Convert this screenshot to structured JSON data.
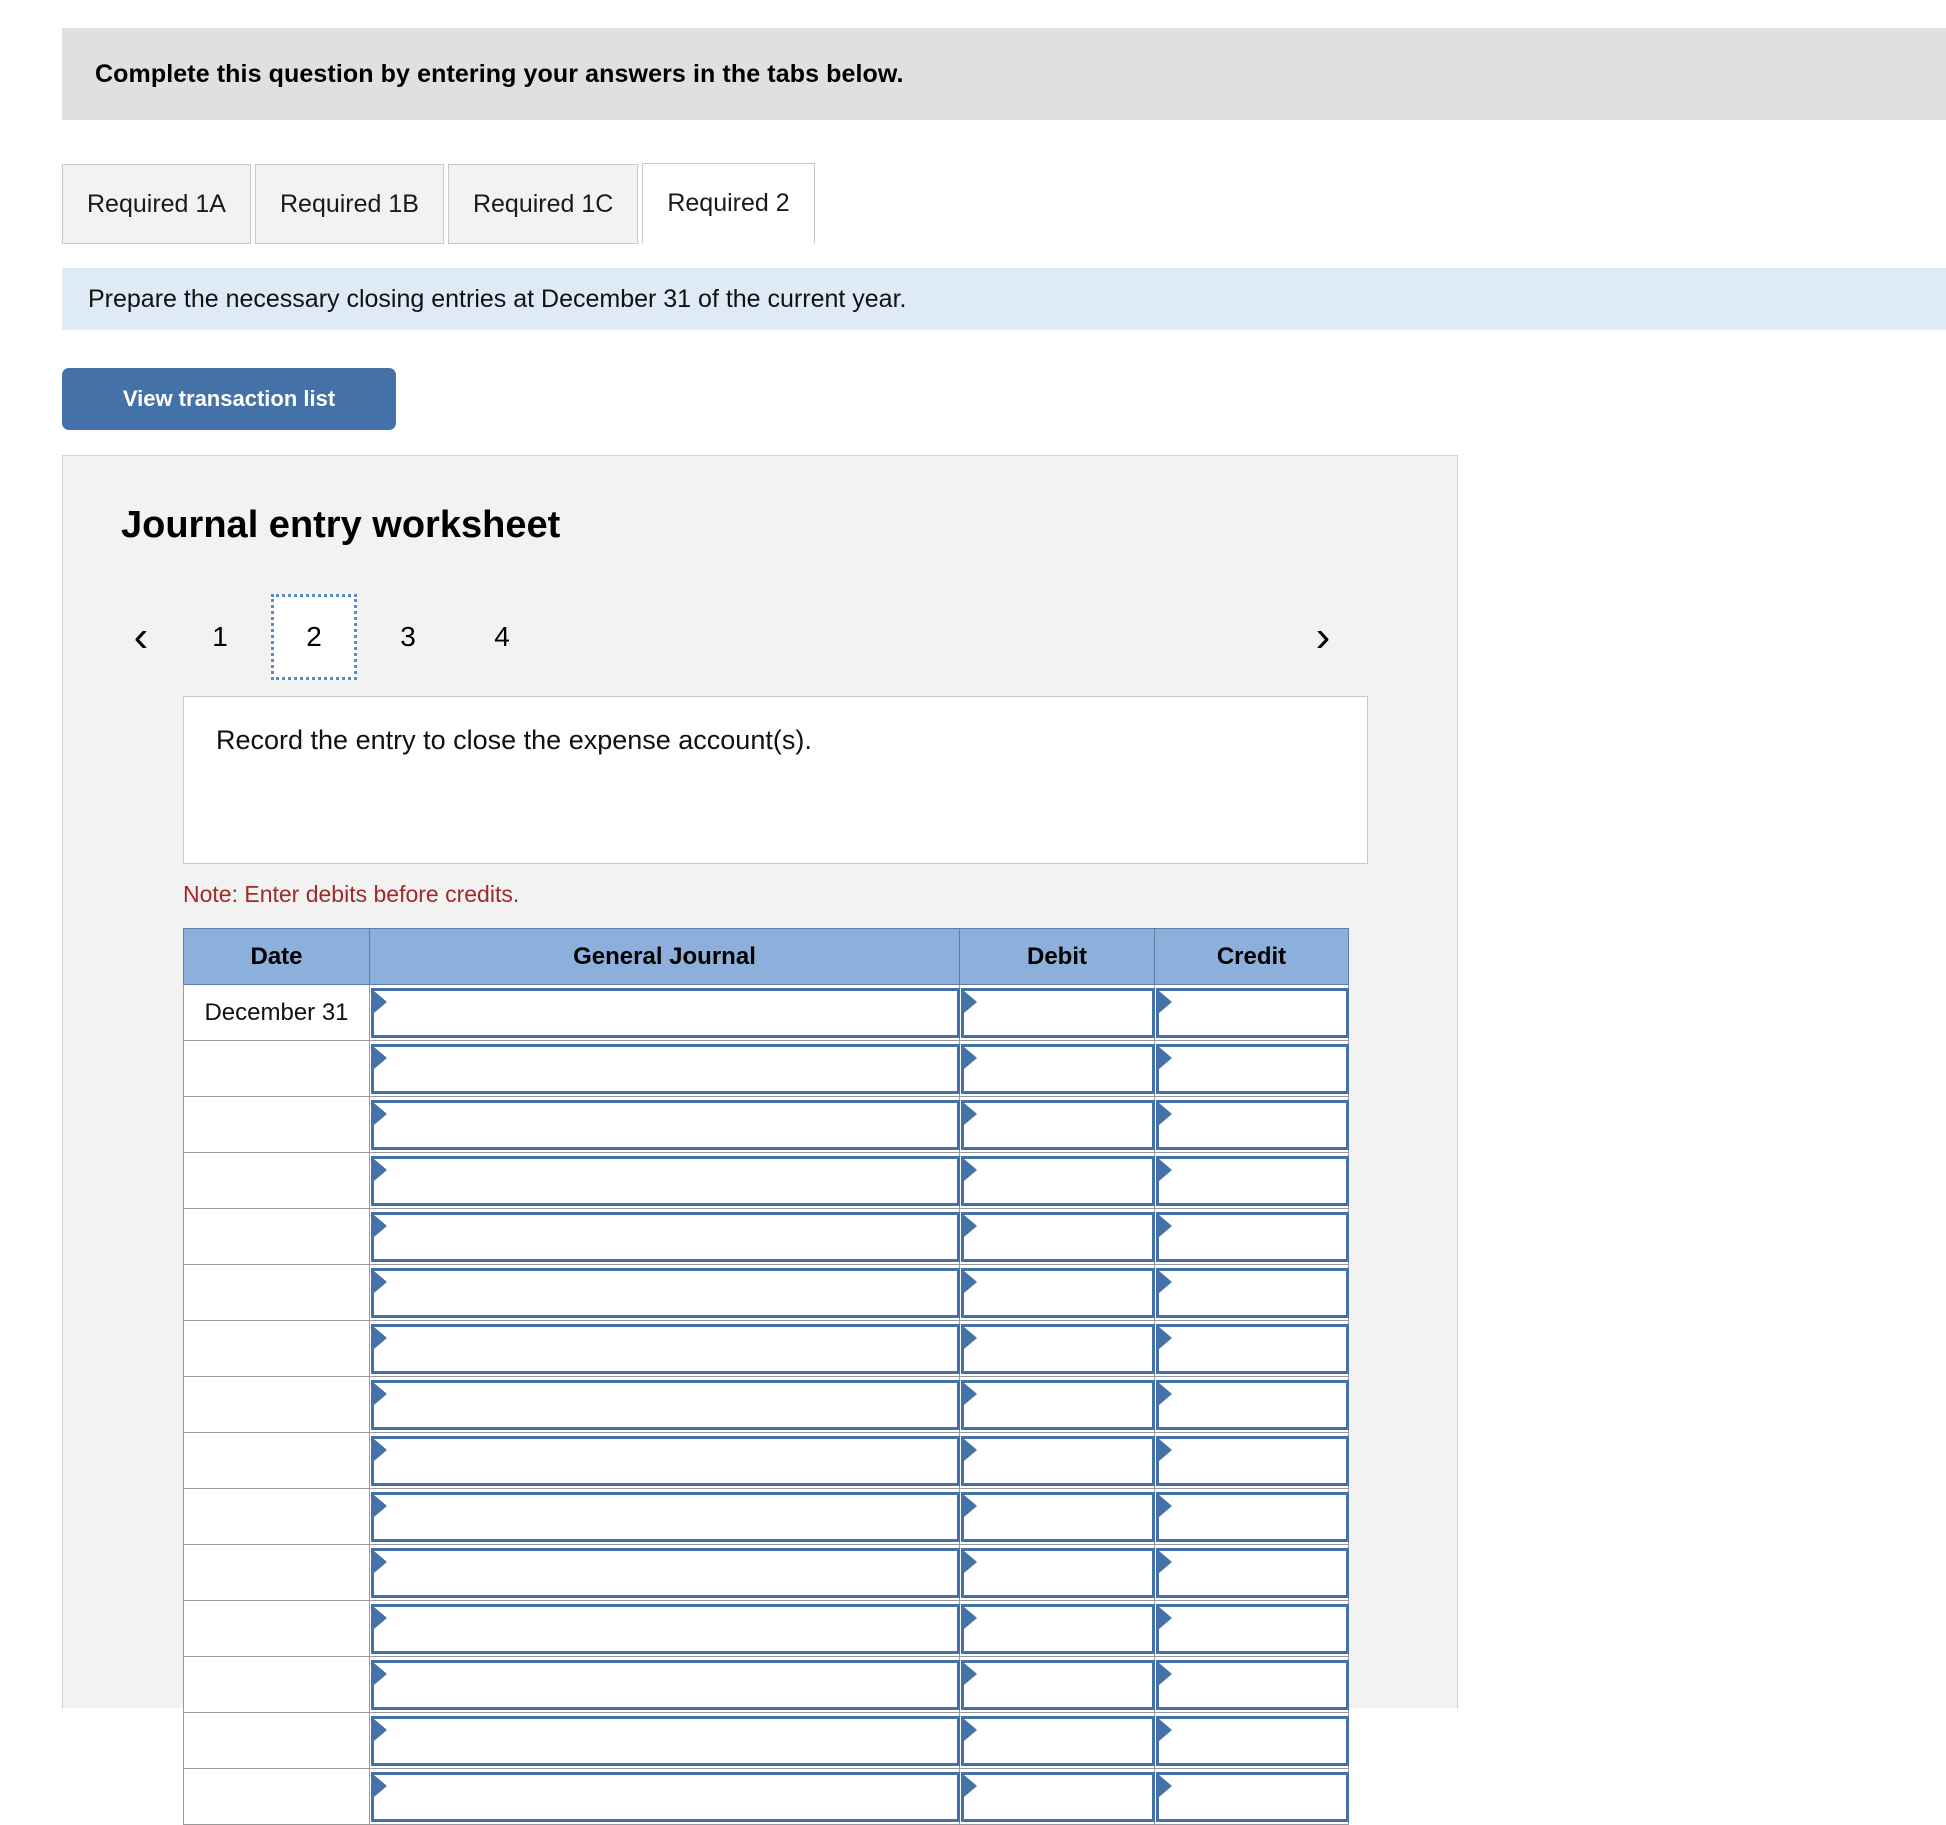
{
  "header": {
    "prompt": "Complete this question by entering your answers in the tabs below."
  },
  "tabs": [
    {
      "label": "Required 1A",
      "active": false
    },
    {
      "label": "Required 1B",
      "active": false
    },
    {
      "label": "Required 1C",
      "active": false
    },
    {
      "label": "Required 2",
      "active": true
    }
  ],
  "instruction": {
    "text": "Prepare the necessary closing entries at December 31 of the current year."
  },
  "toolbar": {
    "view_transaction_list_label": "View transaction list"
  },
  "worksheet": {
    "title": "Journal entry worksheet",
    "pager": {
      "prev_icon": "‹",
      "next_icon": "›",
      "pages": [
        "1",
        "2",
        "3",
        "4"
      ],
      "current_page": "2"
    },
    "task": {
      "text": "Record the entry to close the expense account(s)."
    },
    "note": "Note: Enter debits before credits.",
    "table": {
      "columns": [
        "Date",
        "General Journal",
        "Debit",
        "Credit"
      ],
      "rows": [
        {
          "date": "December 31",
          "general_journal": "",
          "debit": "",
          "credit": ""
        },
        {
          "date": "",
          "general_journal": "",
          "debit": "",
          "credit": ""
        },
        {
          "date": "",
          "general_journal": "",
          "debit": "",
          "credit": ""
        },
        {
          "date": "",
          "general_journal": "",
          "debit": "",
          "credit": ""
        },
        {
          "date": "",
          "general_journal": "",
          "debit": "",
          "credit": ""
        },
        {
          "date": "",
          "general_journal": "",
          "debit": "",
          "credit": ""
        },
        {
          "date": "",
          "general_journal": "",
          "debit": "",
          "credit": ""
        },
        {
          "date": "",
          "general_journal": "",
          "debit": "",
          "credit": ""
        },
        {
          "date": "",
          "general_journal": "",
          "debit": "",
          "credit": ""
        },
        {
          "date": "",
          "general_journal": "",
          "debit": "",
          "credit": ""
        },
        {
          "date": "",
          "general_journal": "",
          "debit": "",
          "credit": ""
        },
        {
          "date": "",
          "general_journal": "",
          "debit": "",
          "credit": ""
        },
        {
          "date": "",
          "general_journal": "",
          "debit": "",
          "credit": ""
        },
        {
          "date": "",
          "general_journal": "",
          "debit": "",
          "credit": ""
        },
        {
          "date": "",
          "general_journal": "",
          "debit": "",
          "credit": ""
        }
      ]
    }
  },
  "colors": {
    "prompt_band": "#e0e0e0",
    "instruction_banner": "#deeaf6",
    "button_blue": "#4472a8",
    "table_header_blue": "#8cafdb",
    "note_red": "#9e2b25",
    "panel_gray": "#f2f2f2"
  }
}
